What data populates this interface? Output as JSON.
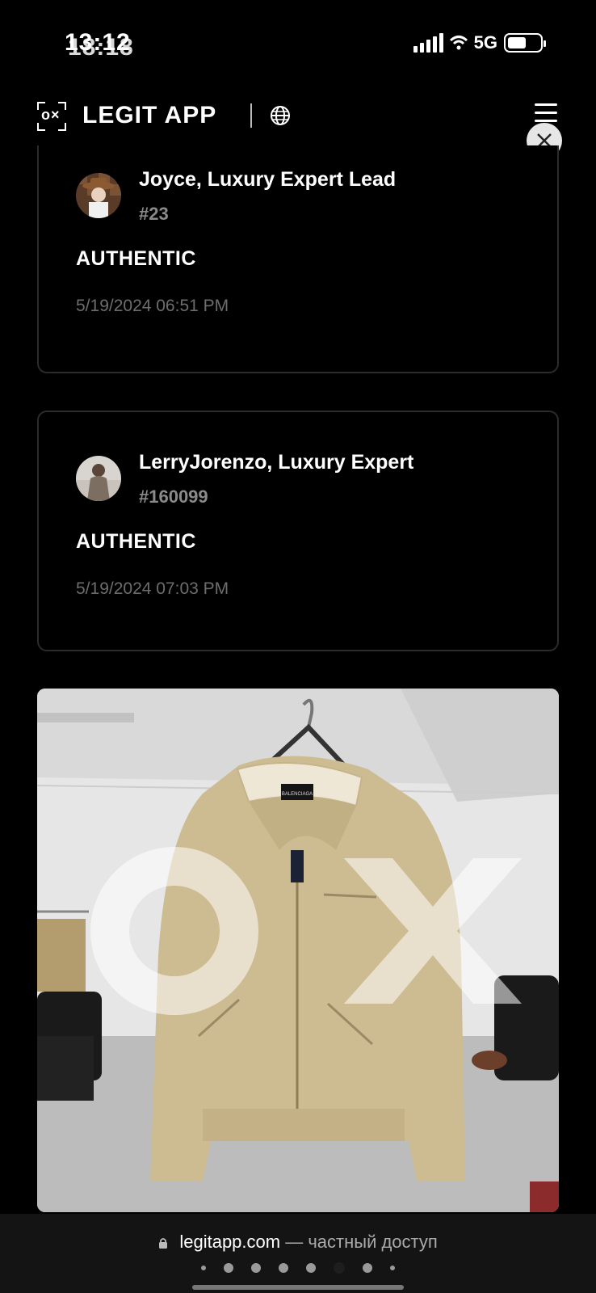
{
  "status_bar": {
    "time": "18:18",
    "time_ghost": "13:12",
    "network": "5G",
    "battery_level": 0.55
  },
  "header": {
    "app_title": "LEGIT APP",
    "logo_mark": "o×",
    "icons": [
      "globe-icon",
      "menu-icon",
      "close-icon"
    ]
  },
  "reviews": [
    {
      "name": "Joyce, Luxury Expert Lead",
      "id": "#23",
      "verdict": "AUTHENTIC",
      "timestamp": "5/19/2024 06:51 PM"
    },
    {
      "name": "LerryJorenzo, Luxury Expert",
      "id": "#160099",
      "verdict": "AUTHENTIC",
      "timestamp": "5/19/2024 07:03 PM"
    }
  ],
  "photo": {
    "tag_text": "BALENCIAGA",
    "colors": {
      "jacket": "#cdbb91",
      "wall": "#e9e9e9",
      "floor": "#bfbfbf"
    }
  },
  "browser_bar": {
    "domain": "legitapp.com",
    "suffix": "— частный доступ"
  },
  "colors": {
    "background": "#000000",
    "card_border": "#2b2b2b",
    "muted_text": "#6d6d6d",
    "id_text": "#8a8a8a"
  }
}
